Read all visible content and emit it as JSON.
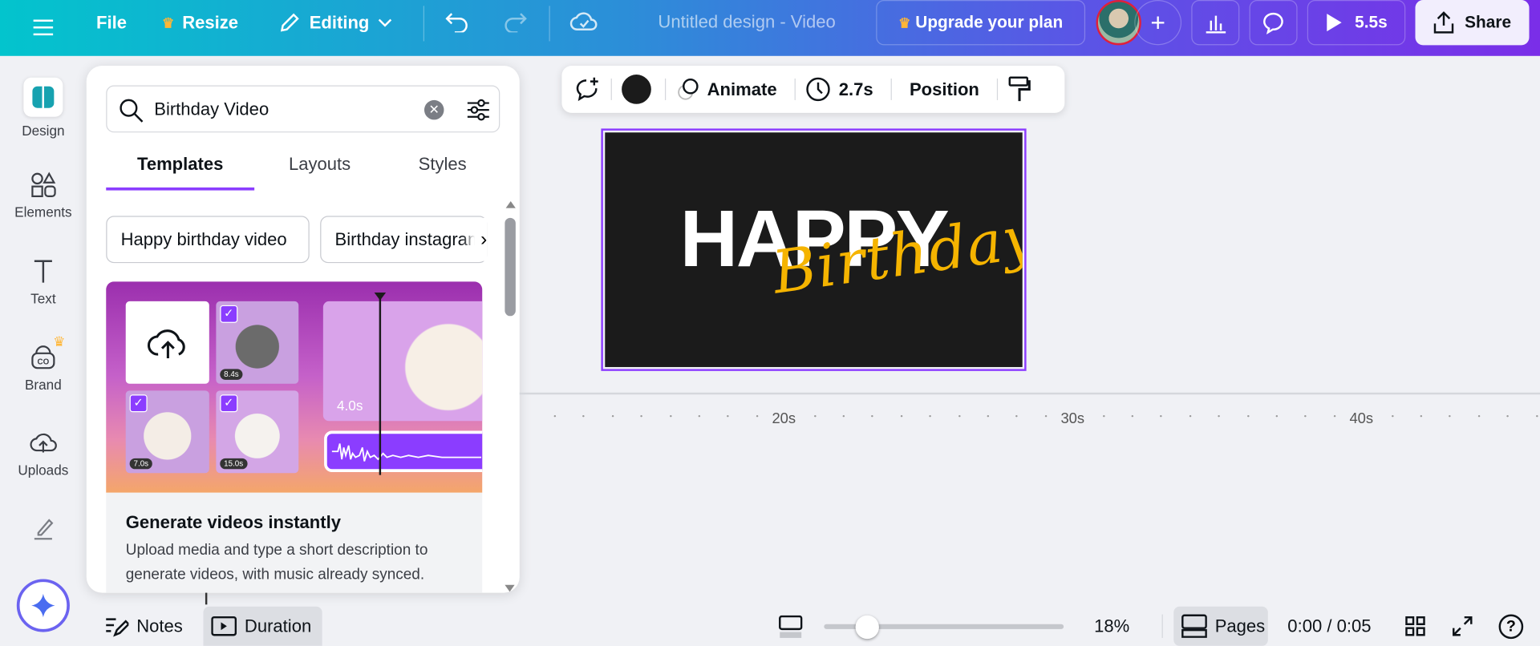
{
  "topbar": {
    "file": "File",
    "resize": "Resize",
    "editing": "Editing",
    "title": "Untitled design - Video",
    "upgrade": "Upgrade your plan",
    "play_duration": "5.5s",
    "share": "Share"
  },
  "sidebar": {
    "items": [
      {
        "label": "Design"
      },
      {
        "label": "Elements"
      },
      {
        "label": "Text"
      },
      {
        "label": "Brand"
      },
      {
        "label": "Uploads"
      }
    ]
  },
  "panel": {
    "search_value": "Birthday Video",
    "tabs": [
      {
        "label": "Templates"
      },
      {
        "label": "Layouts"
      },
      {
        "label": "Styles"
      }
    ],
    "chips": [
      {
        "label": "Happy birthday video"
      },
      {
        "label": "Birthday instagram"
      }
    ],
    "card": {
      "title": "Generate videos instantly",
      "description": "Upload media and type a short description to generate videos, with music already synced.",
      "thumb_times": [
        "8.4s",
        "7.0s",
        "15.0s"
      ],
      "clip_time": "4.0s"
    }
  },
  "floatbar": {
    "animate": "Animate",
    "duration": "2.7s",
    "position": "Position"
  },
  "design": {
    "line1": "HAPPY",
    "line2": "Birthday"
  },
  "timeline": {
    "ticks": [
      "20s",
      "30s",
      "40s"
    ]
  },
  "bottombar": {
    "notes": "Notes",
    "duration": "Duration",
    "zoom": "18%",
    "zoom_fraction": 0.18,
    "pages": "Pages",
    "time": "0:00 / 0:05"
  },
  "colors": {
    "accent": "#8b3dff",
    "text_yellow": "#f5b400",
    "canvas_bg": "#1b1b1b"
  }
}
